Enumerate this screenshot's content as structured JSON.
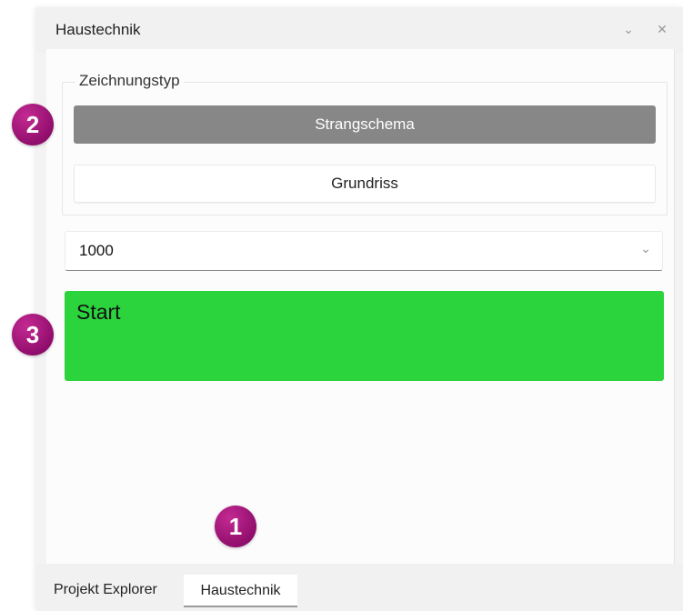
{
  "panel": {
    "title": "Haustechnik",
    "chevron_icon": "chevron-down-icon",
    "close_icon": "close-icon"
  },
  "drawing_type": {
    "legend": "Zeichnungstyp",
    "strangschema_label": "Strangschema",
    "grundriss_label": "Grundriss",
    "selected": "Strangschema"
  },
  "scale_select": {
    "value": "1000"
  },
  "start_button": {
    "label": "Start",
    "color": "#2bd33d"
  },
  "tabs": [
    {
      "label": "Projekt Explorer",
      "active": false
    },
    {
      "label": "Haustechnik",
      "active": true
    }
  ],
  "annotations": {
    "badge_1": "1",
    "badge_2": "2",
    "badge_3": "3",
    "color": "#a0177a"
  }
}
